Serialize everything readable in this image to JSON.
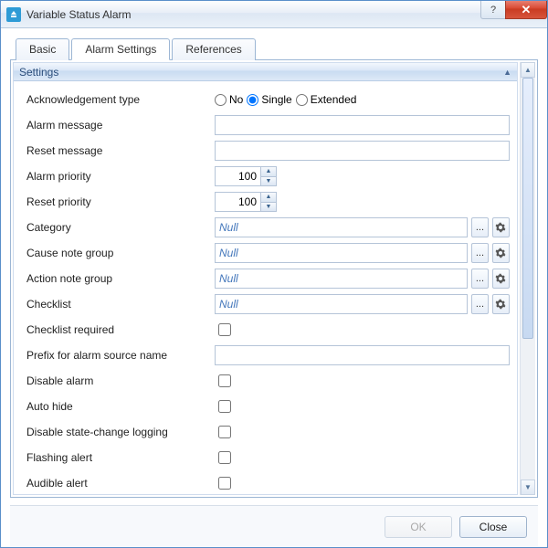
{
  "window": {
    "title": "Variable Status Alarm",
    "help_symbol": "?",
    "close_symbol": "✕"
  },
  "tabs": [
    {
      "label": "Basic"
    },
    {
      "label": "Alarm Settings"
    },
    {
      "label": "References"
    }
  ],
  "active_tab": 1,
  "section": {
    "title": "Settings",
    "collapse_glyph": "▲"
  },
  "ack": {
    "label": "Acknowledgement type",
    "options": {
      "no": "No",
      "single": "Single",
      "extended": "Extended"
    },
    "selected": "single"
  },
  "fields": {
    "alarm_message": {
      "label": "Alarm message",
      "value": ""
    },
    "reset_message": {
      "label": "Reset message",
      "value": ""
    },
    "alarm_priority": {
      "label": "Alarm priority",
      "value": "100"
    },
    "reset_priority": {
      "label": "Reset priority",
      "value": "100"
    },
    "category": {
      "label": "Category",
      "value": "Null",
      "nullish": true
    },
    "cause_note": {
      "label": "Cause note group",
      "value": "Null",
      "nullish": true
    },
    "action_note": {
      "label": "Action note group",
      "value": "Null",
      "nullish": true
    },
    "checklist": {
      "label": "Checklist",
      "value": "Null",
      "nullish": true
    },
    "checklist_req": {
      "label": "Checklist required",
      "checked": false
    },
    "prefix": {
      "label": "Prefix for alarm source name",
      "value": ""
    },
    "disable_alarm": {
      "label": "Disable alarm",
      "checked": false
    },
    "auto_hide": {
      "label": "Auto hide",
      "checked": false
    },
    "disable_logging": {
      "label": "Disable state-change logging",
      "checked": false
    },
    "flashing": {
      "label": "Flashing alert",
      "checked": false
    },
    "audible": {
      "label": "Audible alert",
      "checked": false
    }
  },
  "picker": {
    "browse": "...",
    "gear": "⚙"
  },
  "spinner": {
    "up": "▲",
    "down": "▼"
  },
  "footer": {
    "ok": "OK",
    "close": "Close"
  }
}
